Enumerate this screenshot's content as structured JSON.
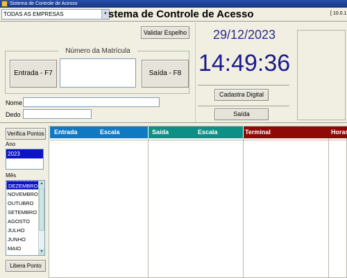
{
  "window": {
    "title": "Sistema de Controle de Acesso"
  },
  "header": {
    "company_select": "TODAS AS EMPRESAS",
    "system_title": "stema de Controle de Acesso",
    "ip_label": "[ 10.0.1"
  },
  "buttons": {
    "validar_espelho": "Validar Espelho",
    "entrada": "Entrada - F7",
    "saida": "Saída - F8",
    "cadastra_digital": "Cadastra Digital",
    "saida_small": "Saída",
    "verifica_pontos": "Verifica Pontos",
    "libera_ponto": "Libera Ponto"
  },
  "matricula": {
    "legend": "Número da Matrícula",
    "value": ""
  },
  "fields": {
    "nome_label": "Nome",
    "nome_value": "",
    "dedo_label": "Dedo",
    "dedo_value": ""
  },
  "clock": {
    "date": "29/12/2023",
    "time": "14:49:36"
  },
  "filters": {
    "ano_label": "Ano",
    "ano_items": [
      "2023"
    ],
    "mes_label": "Mês",
    "mes_items": [
      "DEZEMBRO",
      "NOVEMBRO",
      "OUTUBRO",
      "SETEMBRO",
      "AGOSTO",
      "JULHO",
      "JUNHO",
      "MAIO"
    ],
    "mes_selected": "DEZEMBRO"
  },
  "grid": {
    "columns": [
      "Entrada",
      "Escala",
      "Saída",
      "Escala",
      "Terminal",
      "Horas"
    ],
    "colors": {
      "entrada": "#0f79c4",
      "saida": "#0e8f86",
      "terminal": "#8f0a06"
    }
  }
}
